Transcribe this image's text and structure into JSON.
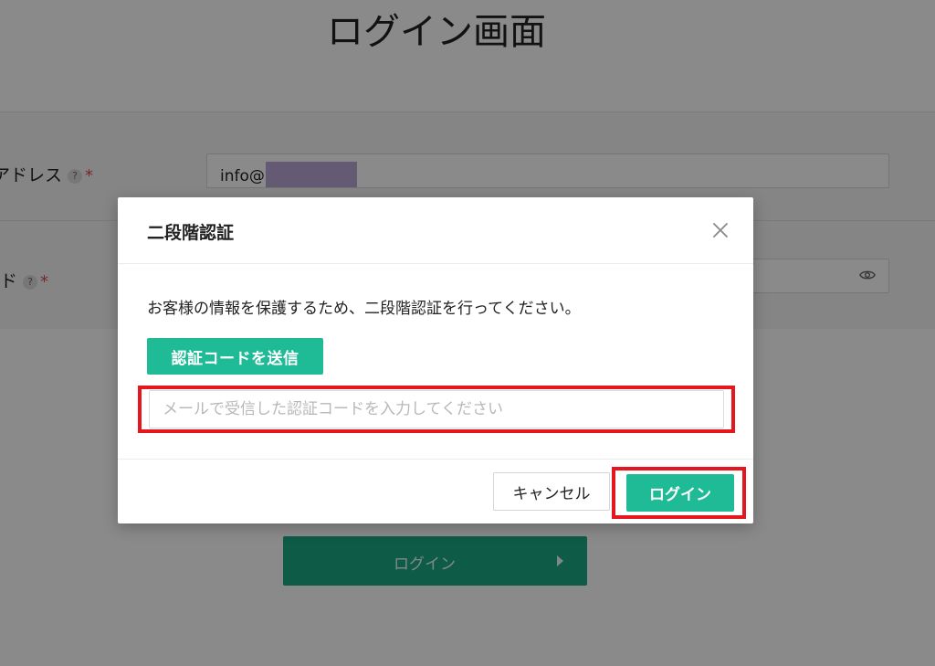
{
  "page": {
    "title": "ログイン画面",
    "email_label": "アドレス",
    "email_value": "info@",
    "password_label": "ド",
    "help_mark": "?",
    "required_mark": "*",
    "submit_label": "ログイン"
  },
  "modal": {
    "title": "二段階認証",
    "message": "お客様の情報を保護するため、二段階認証を行ってください。",
    "send_code_label": "認証コードを送信",
    "code_placeholder": "メールで受信した認証コードを入力してください",
    "cancel_label": "キャンセル",
    "login_label": "ログイン"
  },
  "colors": {
    "accent": "#1fbb96",
    "highlight": "#e6161e",
    "required": "#e04848"
  },
  "icons": {
    "close": "close-icon",
    "eye": "eye-icon",
    "help": "help-icon",
    "arrow": "play-arrow-icon"
  }
}
